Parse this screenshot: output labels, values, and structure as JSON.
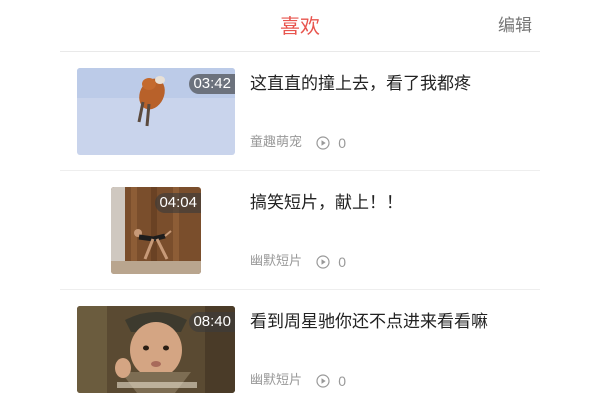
{
  "header": {
    "title": "喜欢",
    "edit_label": "编辑"
  },
  "colors": {
    "accent": "#e8554e",
    "title_text": "#222222",
    "meta_text": "#999999"
  },
  "videos": [
    {
      "duration": "03:42",
      "title": "这直直的撞上去，看了我都疼",
      "category": "童趣萌宠",
      "play_count": "0",
      "thumbnail": "fox-jumping-into-snow"
    },
    {
      "duration": "04:04",
      "title": "搞笑短片，献上！！",
      "category": "幽默短片",
      "play_count": "0",
      "thumbnail": "person-dancing-indoors"
    },
    {
      "duration": "08:40",
      "title": "看到周星驰你还不点进来看看嘛",
      "category": "幽默短片",
      "play_count": "0",
      "thumbnail": "movie-actor-closeup"
    }
  ]
}
